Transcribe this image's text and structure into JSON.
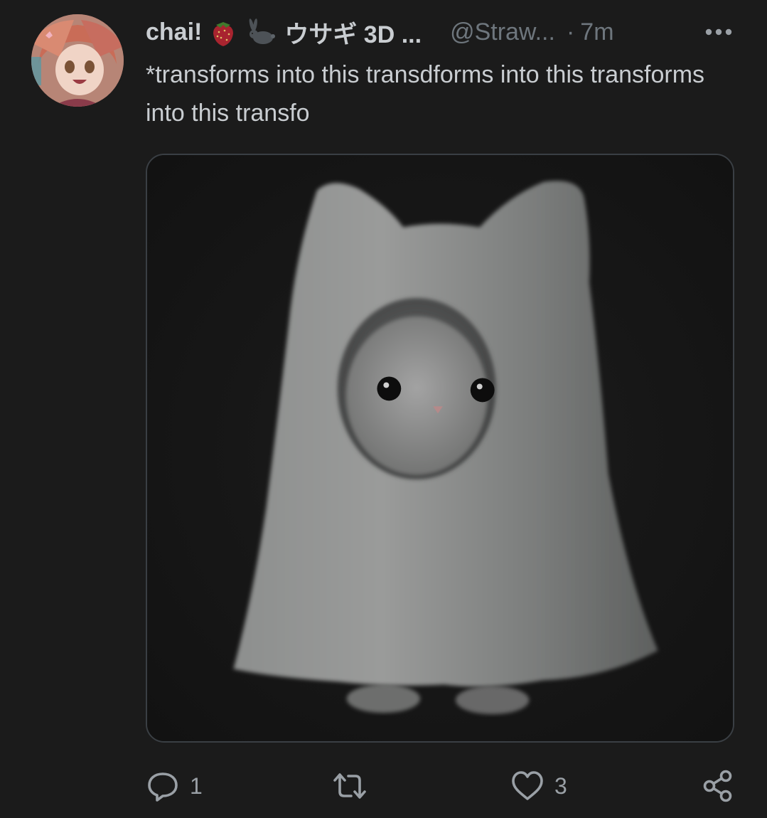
{
  "tweet": {
    "display_name": "chai!",
    "emojis": [
      "strawberry-emoji",
      "rabbit-emoji"
    ],
    "jp_name": "ウサギ 3D ...",
    "handle": "@Straw...",
    "separator": "·",
    "time": "7m",
    "text": "*transforms into this transdforms into this transforms into this transfo",
    "media": {
      "subject": "ghost-cat-figure"
    }
  },
  "actions": {
    "reply": {
      "icon": "reply-icon",
      "count": "1"
    },
    "retweet": {
      "icon": "retweet-icon",
      "count": ""
    },
    "like": {
      "icon": "heart-icon",
      "count": "3"
    },
    "share": {
      "icon": "share-icon"
    }
  },
  "colors": {
    "background": "#1b1b1b",
    "text": "#c9cdd1",
    "muted": "#6e767d",
    "border": "#3a3f44"
  }
}
